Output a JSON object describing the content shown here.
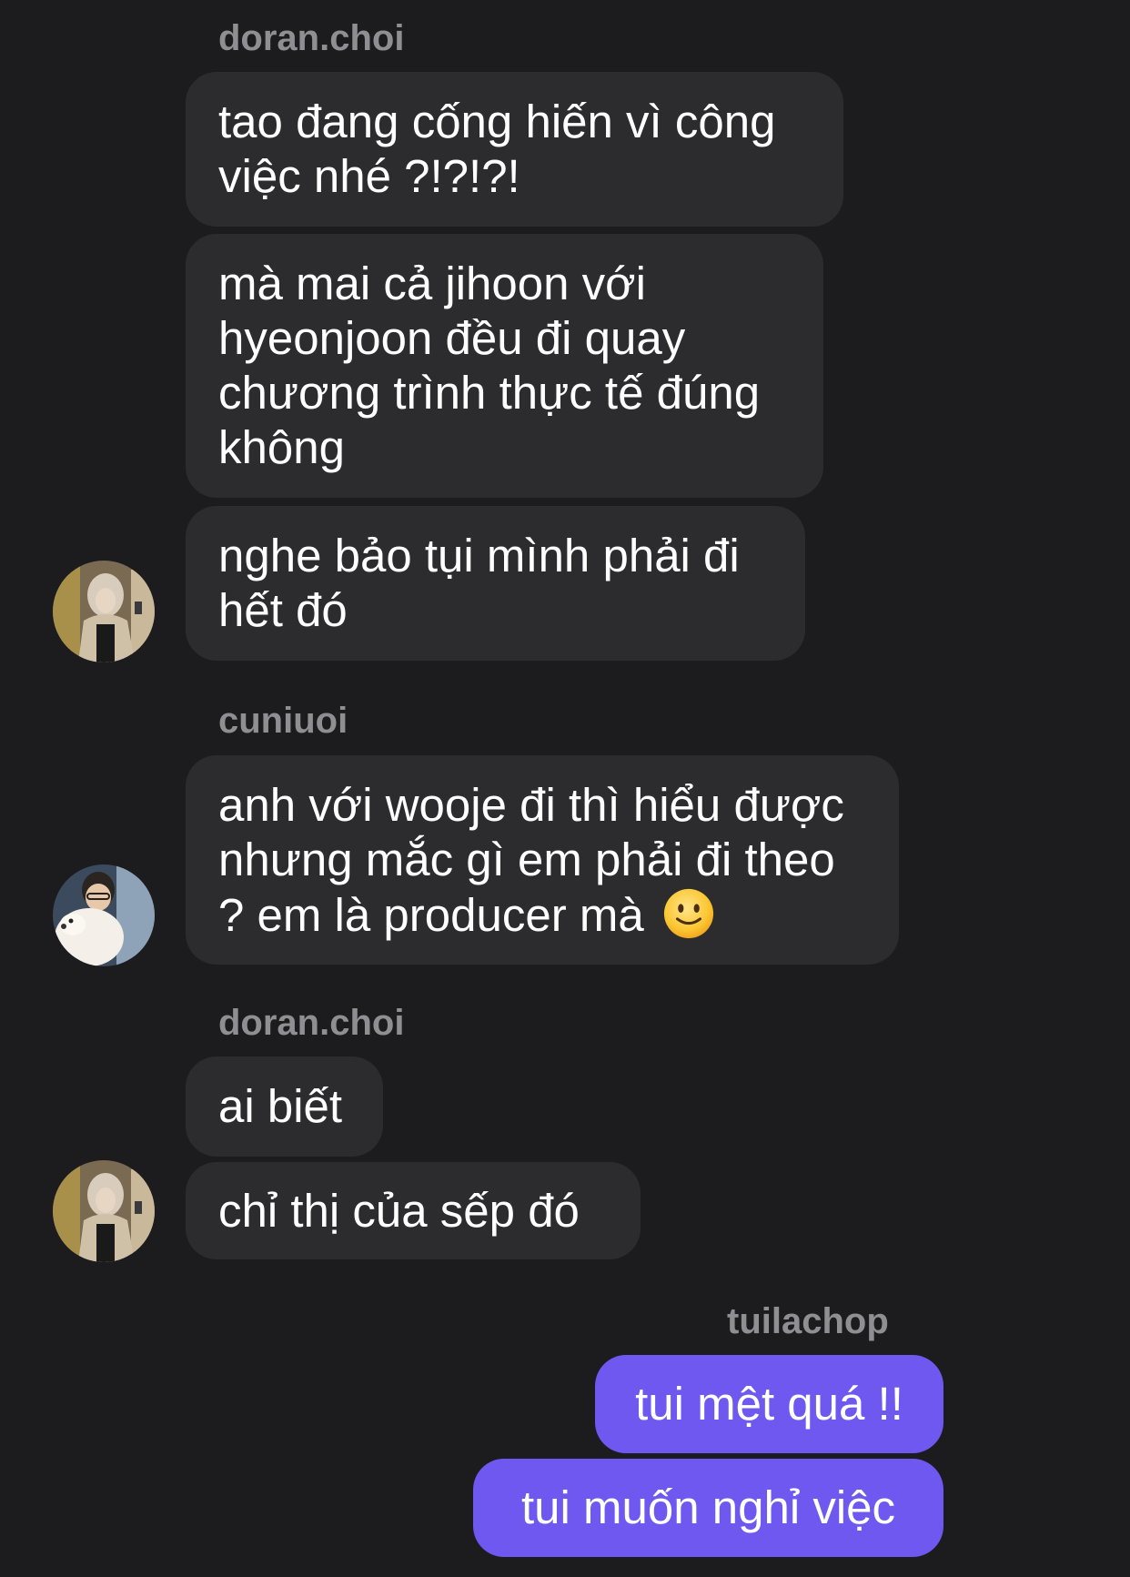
{
  "conversation": {
    "groups": [
      {
        "sender": "doran.choi",
        "messages": [
          "tao đang cống hiến vì công việc nhé ?!?!?!",
          "mà mai cả jihoon với hyeonjoon đều đi quay chương trình thực tế đúng không",
          "nghe bảo tụi mình phải đi hết đó"
        ]
      },
      {
        "sender": "cuniuoi",
        "messages": [
          "anh với wooje đi thì hiểu được nhưng mắc gì em phải đi theo ? em là producer mà"
        ],
        "emoji": "slightly-smiling-face-icon"
      },
      {
        "sender": "doran.choi",
        "messages": [
          "ai biết",
          "chỉ thị của sếp đó"
        ]
      },
      {
        "sender": "tuilachop",
        "messages": [
          "tui mệt quá !!",
          "tui muốn nghỉ việc"
        ]
      }
    ]
  },
  "colors": {
    "background": "#1c1c1e",
    "incoming_bubble": "#2c2c2e",
    "outgoing_bubble": "#6f58f0",
    "sender_name": "#8e8e93"
  }
}
